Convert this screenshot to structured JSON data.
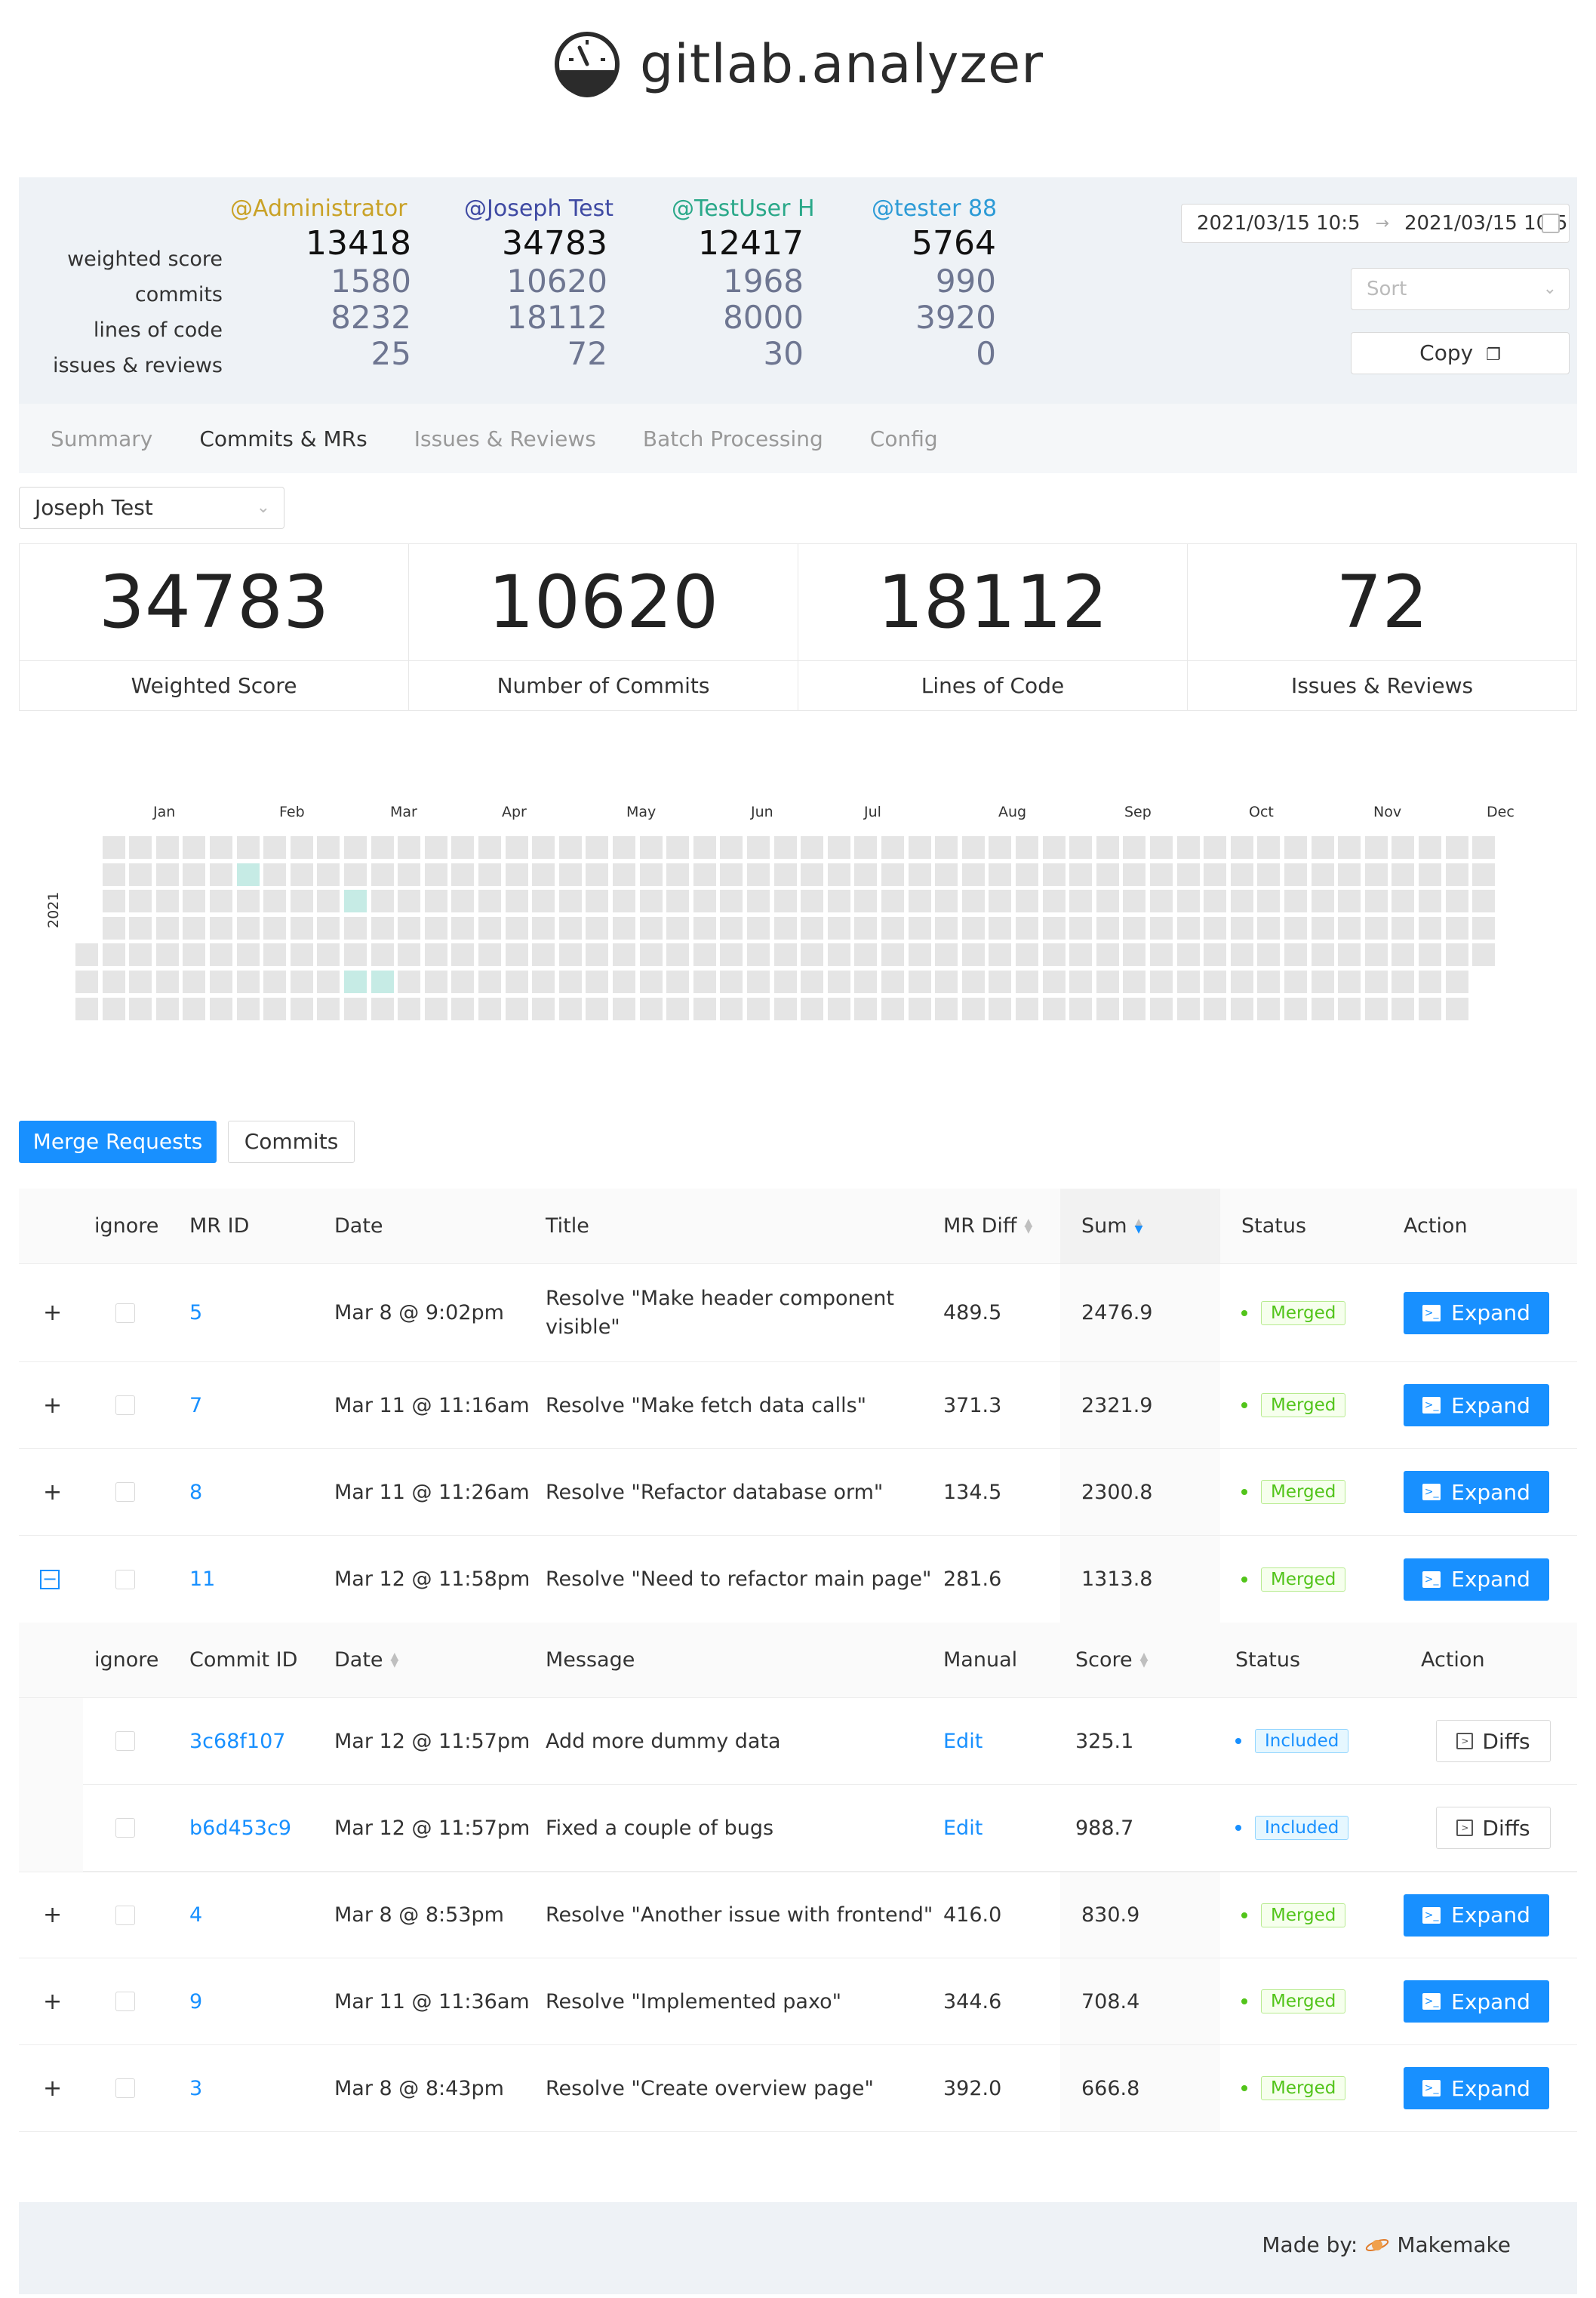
{
  "app": {
    "title": "gitlab.analyzer"
  },
  "summary": {
    "labels": [
      "weighted score",
      "commits",
      "lines of code",
      "issues & reviews"
    ],
    "users": [
      {
        "name": "@Administrator",
        "color": "#c9a227",
        "weighted": "13418",
        "commits": "1580",
        "loc": "8232",
        "issues": "25"
      },
      {
        "name": "@Joseph Test",
        "color": "#3f4aa3",
        "weighted": "34783",
        "commits": "10620",
        "loc": "18112",
        "issues": "72"
      },
      {
        "name": "@TestUser H",
        "color": "#2aa889",
        "weighted": "12417",
        "commits": "1968",
        "loc": "8000",
        "issues": "30"
      },
      {
        "name": "@tester 88",
        "color": "#2d9bd6",
        "weighted": "5764",
        "commits": "990",
        "loc": "3920",
        "issues": "0"
      }
    ],
    "date_start": "2021/03/15 10:5",
    "date_end": "2021/03/15 10:5",
    "sort_placeholder": "Sort",
    "copy_label": "Copy"
  },
  "tabs": [
    "Summary",
    "Commits & MRs",
    "Issues & Reviews",
    "Batch Processing",
    "Config"
  ],
  "active_tab": "Commits & MRs",
  "selected_user": "Joseph Test",
  "stats": [
    {
      "value": "34783",
      "label": "Weighted Score"
    },
    {
      "value": "10620",
      "label": "Number of Commits"
    },
    {
      "value": "18112",
      "label": "Lines of Code"
    },
    {
      "value": "72",
      "label": "Issues & Reviews"
    }
  ],
  "heatmap": {
    "year": "2021",
    "months": [
      "Jan",
      "Feb",
      "Mar",
      "Apr",
      "May",
      "Jun",
      "Jul",
      "Aug",
      "Sep",
      "Oct",
      "Nov",
      "Dec"
    ],
    "active_color": "#c6ebe5",
    "empty_color": "#e5e5e5"
  },
  "view_toggle": {
    "mr": "Merge Requests",
    "commits": "Commits"
  },
  "mr_table": {
    "headers": {
      "ignore": "ignore",
      "id": "MR ID",
      "date": "Date",
      "title": "Title",
      "diff": "MR Diff",
      "sum": "Sum",
      "status": "Status",
      "action": "Action"
    },
    "expand_label": "Expand",
    "rows_top": [
      {
        "id": "5",
        "date": "Mar 8 @ 9:02pm",
        "title_line1": "Resolve \"Make header component",
        "title_line2": "visible\"",
        "diff": "489.5",
        "sum": "2476.9",
        "status": "Merged"
      },
      {
        "id": "7",
        "date": "Mar 11 @ 11:16am",
        "title_line1": "Resolve \"Make fetch data calls\"",
        "title_line2": "",
        "diff": "371.3",
        "sum": "2321.9",
        "status": "Merged"
      },
      {
        "id": "8",
        "date": "Mar 11 @ 11:26am",
        "title_line1": "Resolve \"Refactor database orm\"",
        "title_line2": "",
        "diff": "134.5",
        "sum": "2300.8",
        "status": "Merged"
      },
      {
        "id": "11",
        "date": "Mar 12 @ 11:58pm",
        "title_line1": "Resolve \"Need to refactor main page\"",
        "title_line2": "",
        "diff": "281.6",
        "sum": "1313.8",
        "status": "Merged"
      }
    ],
    "sub_headers": {
      "ignore": "ignore",
      "id": "Commit ID",
      "date": "Date",
      "message": "Message",
      "manual": "Manual",
      "score": "Score",
      "status": "Status",
      "action": "Action"
    },
    "diffs_label": "Diffs",
    "commits": [
      {
        "id": "3c68f107",
        "date": "Mar 12 @ 11:57pm",
        "message": "Add more dummy data",
        "manual": "Edit",
        "score": "325.1",
        "status": "Included"
      },
      {
        "id": "b6d453c9",
        "date": "Mar 12 @ 11:57pm",
        "message": "Fixed a couple of bugs",
        "manual": "Edit",
        "score": "988.7",
        "status": "Included"
      }
    ],
    "rows_bottom": [
      {
        "id": "4",
        "date": "Mar 8 @ 8:53pm",
        "title_line1": "Resolve \"Another issue with frontend\"",
        "diff": "416.0",
        "sum": "830.9",
        "status": "Merged"
      },
      {
        "id": "9",
        "date": "Mar 11 @ 11:36am",
        "title_line1": "Resolve \"Implemented paxo\"",
        "diff": "344.6",
        "sum": "708.4",
        "status": "Merged"
      },
      {
        "id": "3",
        "date": "Mar 8 @ 8:43pm",
        "title_line1": "Resolve \"Create overview page\"",
        "diff": "392.0",
        "sum": "666.8",
        "status": "Merged"
      }
    ]
  },
  "footer": {
    "text": "Made by:",
    "brand": "Makemake"
  },
  "colors": {
    "accent": "#1890ff",
    "merged": "#52c41a",
    "included": "#1890ff"
  }
}
